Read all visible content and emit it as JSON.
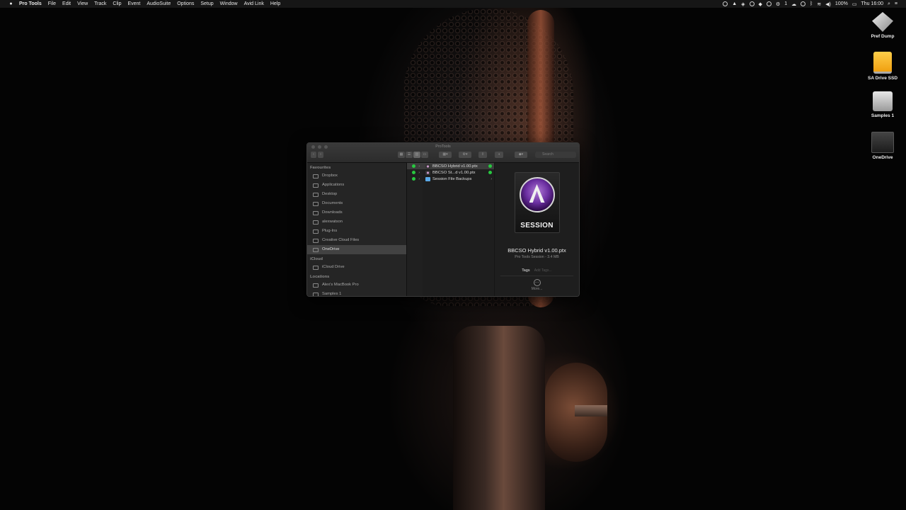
{
  "menubar": {
    "app_name": "Pro Tools",
    "menus": [
      "File",
      "Edit",
      "View",
      "Track",
      "Clip",
      "Event",
      "AudioSuite",
      "Options",
      "Setup",
      "Window",
      "Avid Link",
      "Help"
    ],
    "battery": "100%",
    "clock": "Thu 16:00",
    "badge_count": "1"
  },
  "desktop_icons": [
    {
      "label": "Pref Dump",
      "icon": "pref-dump-icon"
    },
    {
      "label": "SA Drive SSD",
      "icon": "external-drive-icon"
    },
    {
      "label": "Samples 1",
      "icon": "hard-drive-icon"
    },
    {
      "label": "OneDrive",
      "icon": "onedrive-drive-icon"
    }
  ],
  "finder": {
    "window_title": "ProTools",
    "search_placeholder": "Search",
    "sidebar": {
      "favourites_header": "Favourites",
      "favourites": [
        {
          "label": "Dropbox",
          "icon": "dropbox-icon"
        },
        {
          "label": "Applications",
          "icon": "applications-icon"
        },
        {
          "label": "Desktop",
          "icon": "desktop-icon"
        },
        {
          "label": "Documents",
          "icon": "documents-icon"
        },
        {
          "label": "Downloads",
          "icon": "downloads-icon"
        },
        {
          "label": "alexwatson",
          "icon": "home-icon"
        },
        {
          "label": "Plug-Ins",
          "icon": "folder-icon"
        },
        {
          "label": "Creative Cloud Files",
          "icon": "creative-cloud-icon"
        },
        {
          "label": "OneDrive",
          "icon": "cloud-icon",
          "selected": true
        }
      ],
      "icloud_header": "iCloud",
      "icloud": [
        {
          "label": "iCloud Drive",
          "icon": "icloud-icon"
        }
      ],
      "locations_header": "Locations",
      "locations": [
        {
          "label": "Alex's MacBook Pro",
          "icon": "laptop-icon"
        },
        {
          "label": "Samples 1",
          "icon": "hard-drive-icon"
        }
      ]
    },
    "files": [
      {
        "name": "BBCSO Hybrid v1.00.ptx",
        "type": "ptx",
        "selected": true
      },
      {
        "name": "BBCSO St...d v1.00.ptx",
        "type": "ptx"
      },
      {
        "name": "Session File Backups",
        "type": "folder"
      }
    ],
    "preview": {
      "badge_text": "SESSION",
      "file_name": "BBCSO Hybrid v1.00.ptx",
      "meta": "Pro Tools Session - 3.4 MB",
      "tags_label": "Tags",
      "tags_placeholder": "Add Tags...",
      "more_label": "More..."
    }
  }
}
